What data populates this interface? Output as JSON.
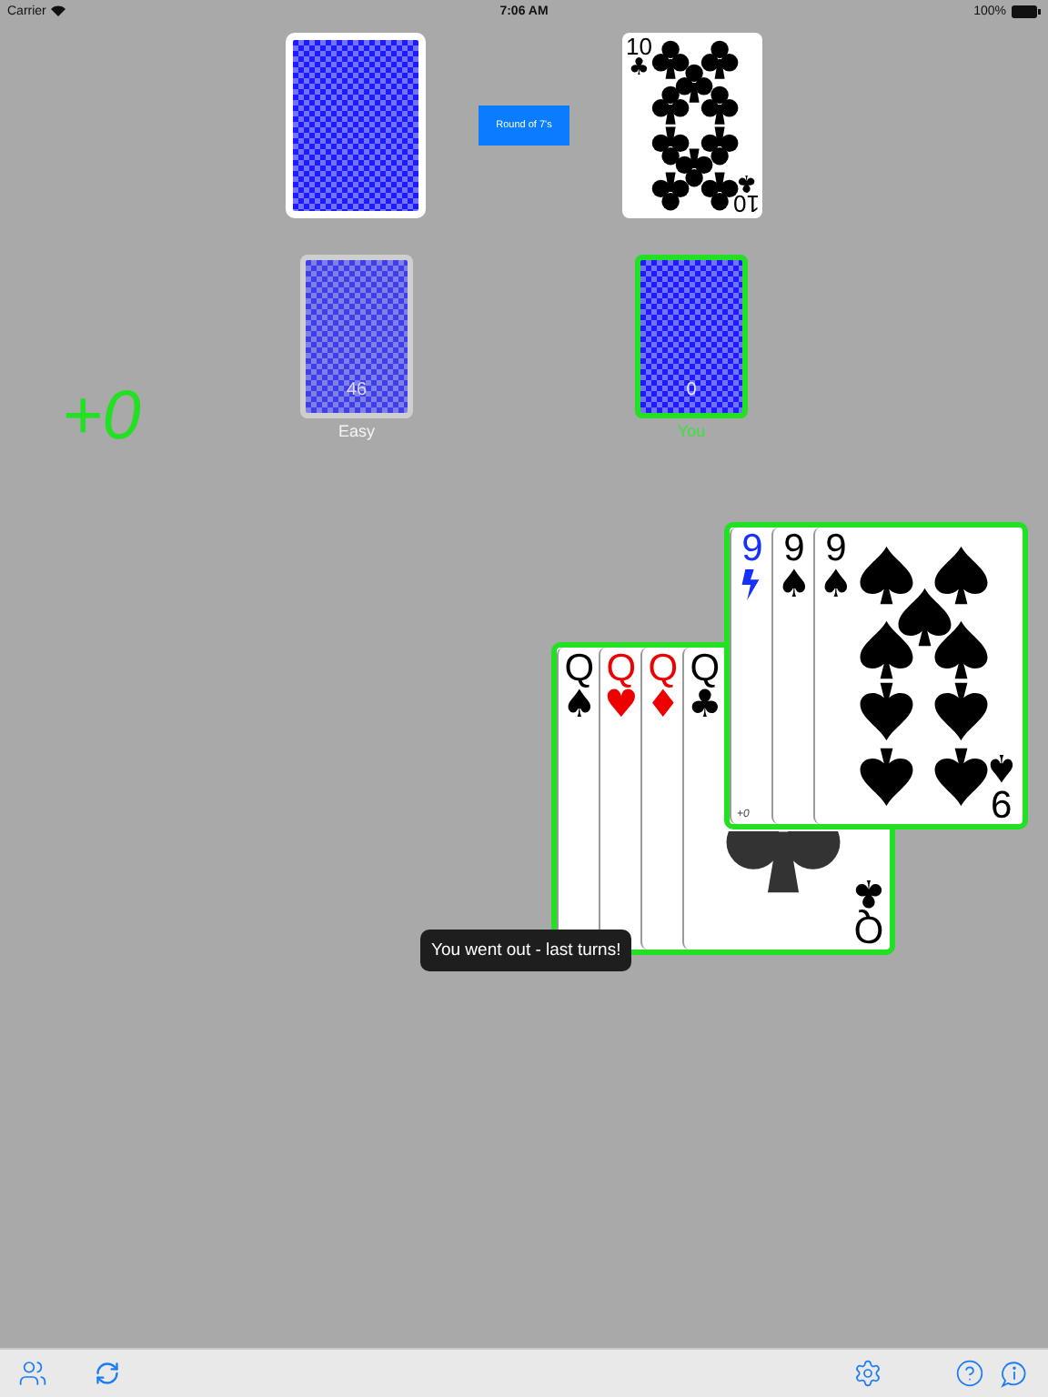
{
  "status_bar": {
    "carrier": "Carrier",
    "time": "7:06 AM",
    "battery": "100%"
  },
  "round_button": "Round of 7's",
  "discard": {
    "kind": "club-ten",
    "rank": "10",
    "bottom_rank": "10",
    "suit": "♣",
    "bottom_suit": "♣",
    "color": "#000000"
  },
  "piles": [
    {
      "label": "Easy",
      "count": "46",
      "selected": false
    },
    {
      "label": "You",
      "count": "0",
      "selected": true
    }
  ],
  "score": "+0",
  "melds": [
    {
      "selected": true,
      "cards": [
        {
          "kind": "spade-face",
          "rank": "Q",
          "suit": "♠",
          "color": "#000000"
        },
        {
          "kind": "heart-face",
          "rank": "Q",
          "suit": "♥",
          "color": "#ee0000"
        },
        {
          "kind": "diamond-face",
          "rank": "Q",
          "suit": "♦",
          "color": "#ee0000"
        },
        {
          "kind": "club-face",
          "rank": "Q",
          "suit": "♣",
          "bottom_rank": "Q",
          "bottom_suit": "♣",
          "color": "#000000"
        }
      ]
    },
    {
      "selected": true,
      "note": "+0",
      "cards": [
        {
          "kind": "bolt",
          "rank": "9",
          "color": "#1530ff"
        },
        {
          "kind": "spade-nine",
          "rank": "9",
          "suit": "♠",
          "color": "#000000"
        },
        {
          "kind": "spade-nine",
          "rank": "9",
          "suit": "♠",
          "bottom_rank": "9",
          "bottom_suit": "♠",
          "color": "#000000"
        }
      ]
    }
  ],
  "toast": "You went out - last turns!"
}
